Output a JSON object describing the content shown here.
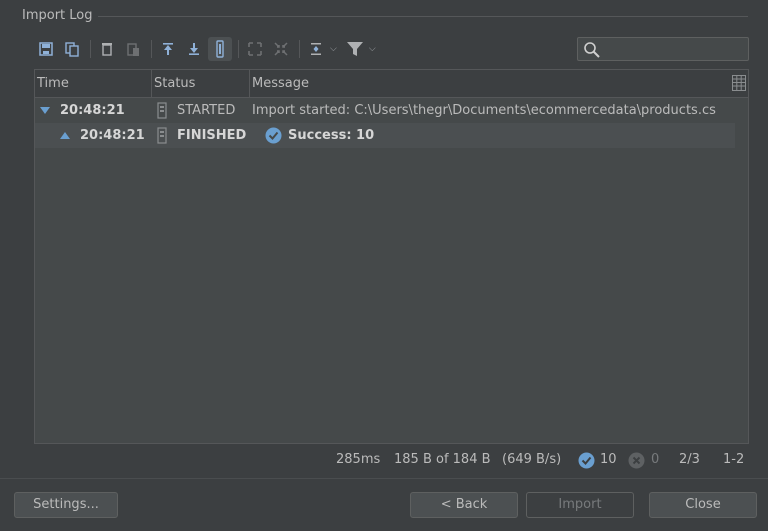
{
  "dialog": {
    "group_title": "Import Log"
  },
  "toolbar": {
    "buttons": [
      {
        "icon": "save-icon"
      },
      {
        "icon": "copy-icon"
      },
      {
        "icon": "clear-icon"
      },
      {
        "icon": "paste-icon"
      },
      {
        "icon": "scroll-top-icon"
      },
      {
        "icon": "scroll-bottom-icon"
      },
      {
        "icon": "autoscroll-icon",
        "active": true
      },
      {
        "icon": "expand-all-icon"
      },
      {
        "icon": "collapse-all-icon"
      },
      {
        "icon": "align-icon"
      },
      {
        "icon": "filter-icon"
      }
    ]
  },
  "search": {
    "value": "",
    "placeholder": ""
  },
  "table": {
    "columns": [
      "Time",
      "Status",
      "Message"
    ],
    "rows": [
      {
        "time": "20:48:21",
        "status": "STARTED",
        "message": "Import started: C:\\Users\\thegr\\Documents\\ecommercedata\\products.cs",
        "expanded": true,
        "level": 0
      },
      {
        "time": "20:48:21",
        "status": "FINISHED",
        "message": "Success: 10",
        "level": 1,
        "selected": true
      }
    ]
  },
  "status_bar": {
    "elapsed": "285ms",
    "size": "185 B of 184 B",
    "rate": "(649 B/s)",
    "success_count": "10",
    "error_count": "0",
    "page": "2/3",
    "range": "1-2"
  },
  "buttons": {
    "settings": "Settings...",
    "back": "< Back",
    "import": "Import",
    "close": "Close"
  },
  "colors": {
    "background": "#3c3f41",
    "table_bg": "#45494a",
    "selected_row": "#4b4f51",
    "accent": "#5e8fc8",
    "success": "#6a9fd0"
  }
}
